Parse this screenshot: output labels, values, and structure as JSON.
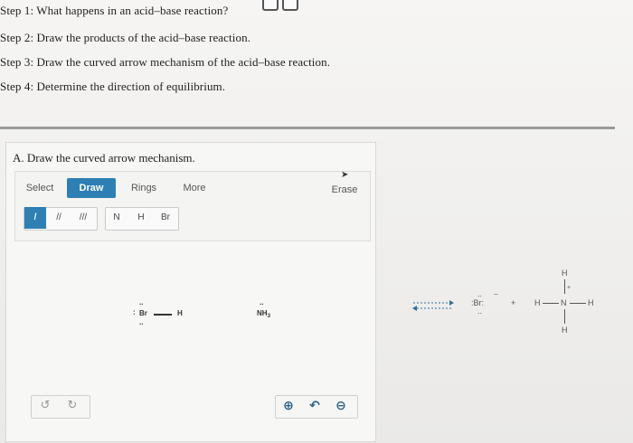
{
  "steps": [
    "Step 1: What happens in an acid–base reaction?",
    "Step 2: Draw the products of the acid–base reaction.",
    "Step 3: Draw the curved arrow mechanism of the acid–base reaction.",
    "Step 4: Determine the direction of equilibrium."
  ],
  "question": {
    "title": "A. Draw the curved arrow mechanism."
  },
  "tabs": {
    "select": "Select",
    "draw": "Draw",
    "rings": "Rings",
    "more": "More",
    "erase": "Erase"
  },
  "tools": {
    "single_bond": "/",
    "double_bond": "//",
    "triple_bond": "///",
    "n": "N",
    "h": "H",
    "br": "Br"
  },
  "canvas": {
    "hbr": {
      "br_lone_top": "..",
      "br_colon": ":",
      "br": "Br",
      "h": "H",
      "br_lone_bottom": ".."
    },
    "nh3": {
      "lone_pair": "..",
      "label": "NH",
      "subscript": "3"
    }
  },
  "products": {
    "bromide": ":Br:",
    "bromide_charge": "−",
    "bromide_lone_top": "..",
    "bromide_lone_bottom": "..",
    "plus": "+",
    "ammonium": {
      "h_top": "H",
      "h_left": "H",
      "n": "N",
      "h_right": "H",
      "h_bottom": "H",
      "charge": "+"
    }
  },
  "colors": {
    "accent": "#2e7fb3",
    "zoom_icon": "#2b5f85"
  },
  "icons": {
    "undo": "undo-icon",
    "redo": "redo-icon",
    "zoom_in": "zoom-in-icon",
    "reset": "reset-icon",
    "zoom_out": "zoom-out-icon"
  }
}
